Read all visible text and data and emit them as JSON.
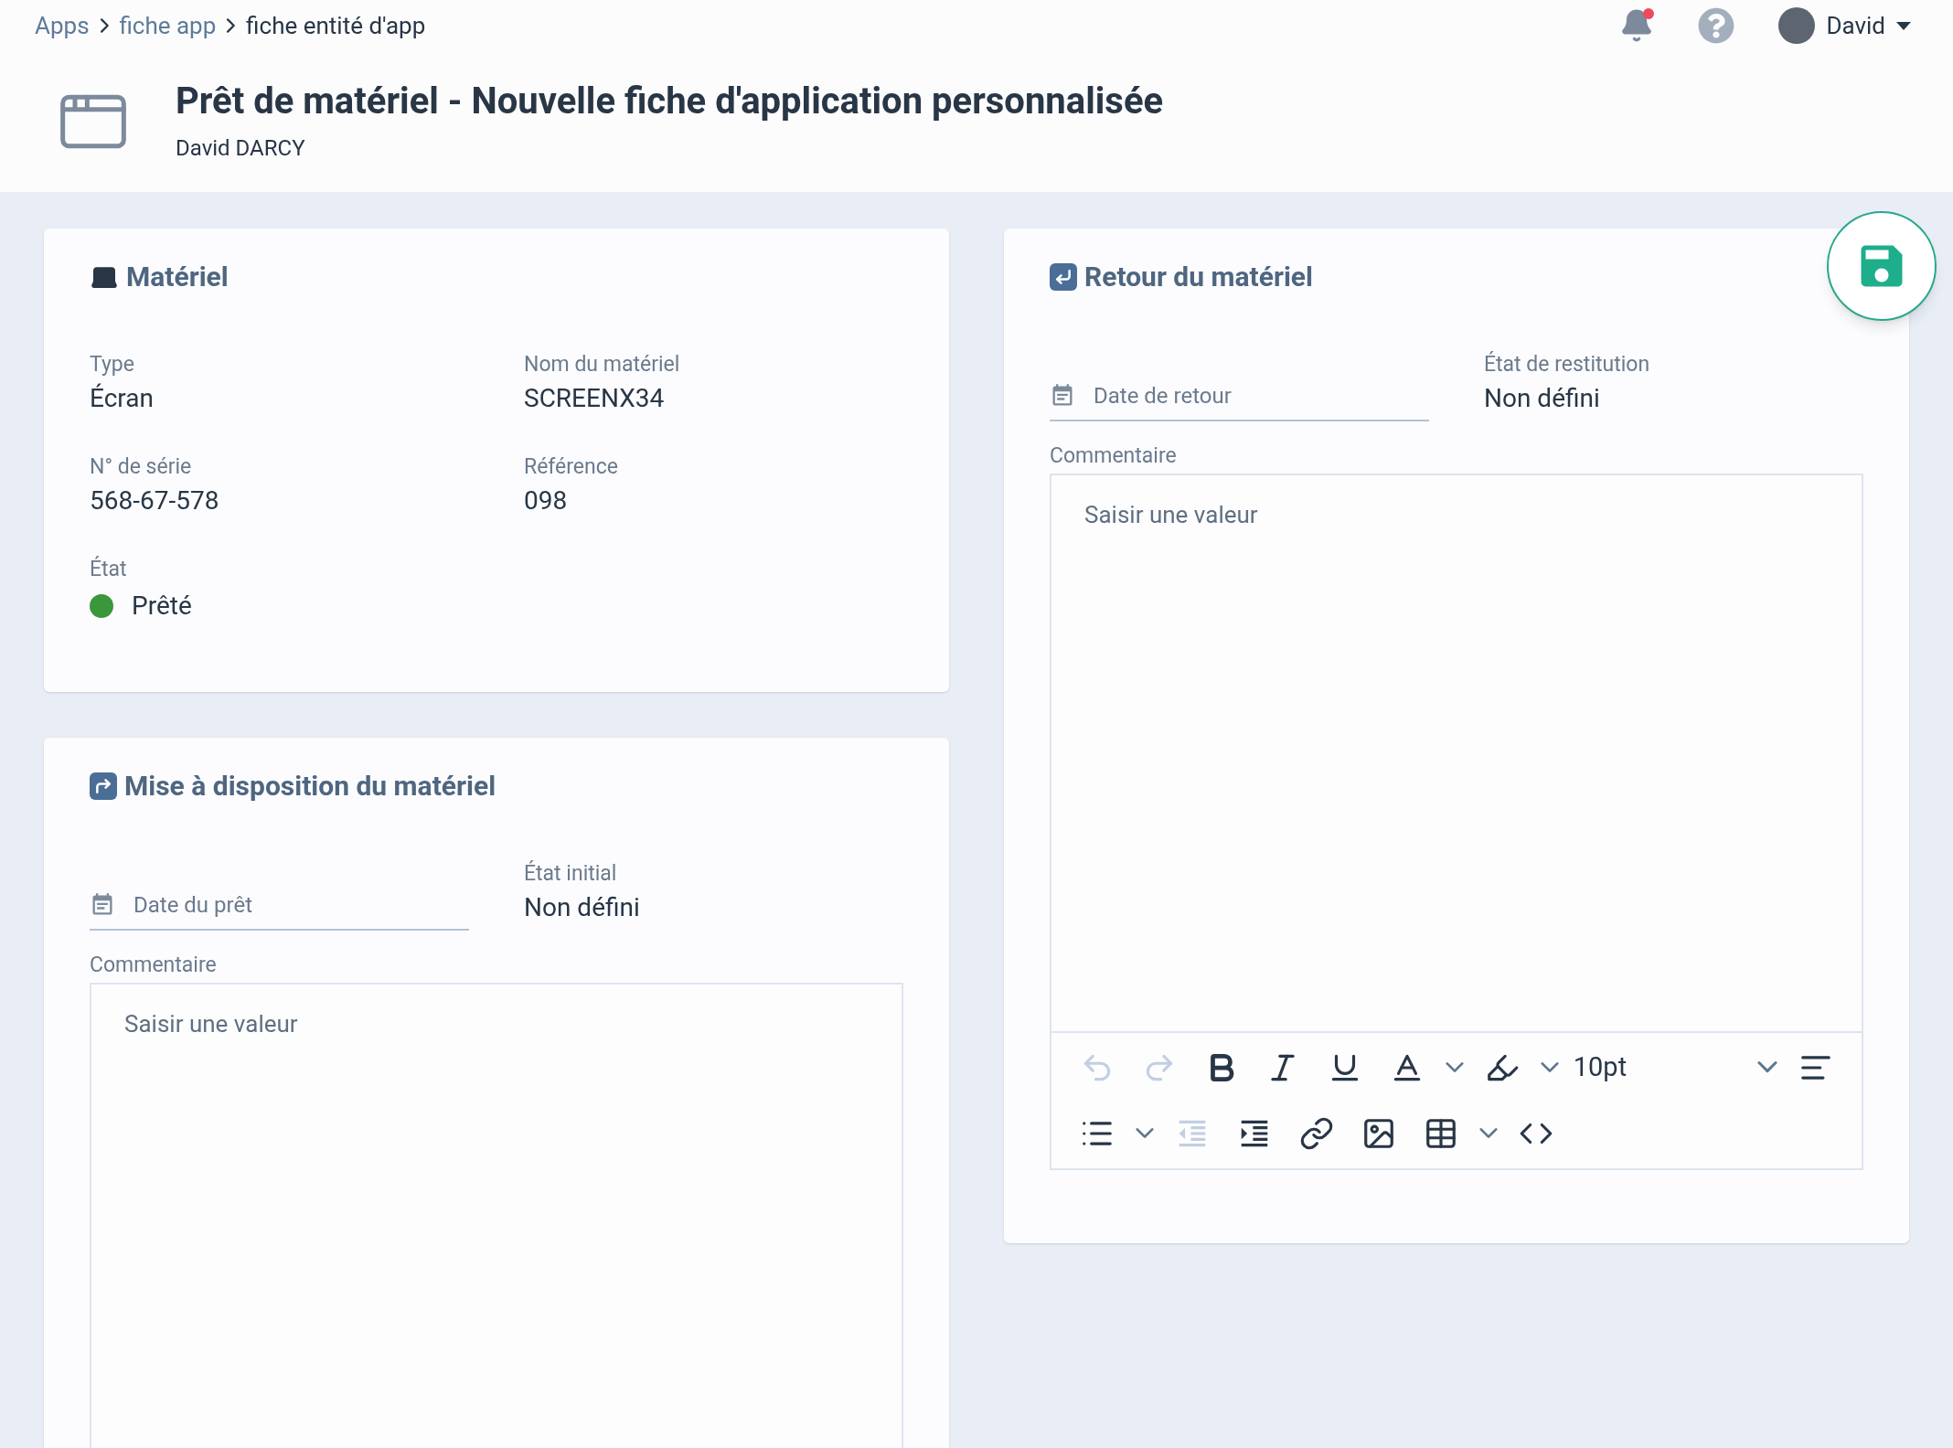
{
  "breadcrumb": [
    {
      "label": "Apps"
    },
    {
      "label": "fiche app"
    },
    {
      "label": "fiche entité d'app"
    }
  ],
  "notifications": {
    "unread": true
  },
  "user": {
    "name": "David"
  },
  "page": {
    "title": "Prêt de matériel - Nouvelle fiche d'application personnalisée",
    "subtitle": "David DARCY"
  },
  "material": {
    "title": "Matériel",
    "fields": [
      {
        "label": "Type",
        "value": "Écran"
      },
      {
        "label": "Nom du matériel",
        "value": "SCREENX34"
      },
      {
        "label": "N° de série",
        "value": "568-67-578"
      },
      {
        "label": "Référence",
        "value": "098"
      }
    ],
    "status": {
      "label": "État",
      "value": "Prêté",
      "color": "#3a973b"
    }
  },
  "loan": {
    "title": "Mise à disposition du matériel",
    "date": {
      "placeholder": "Date du prêt"
    },
    "state": {
      "label": "État initial",
      "value": "Non défini"
    },
    "comment": {
      "label": "Commentaire",
      "placeholder": "Saisir une valeur"
    }
  },
  "return": {
    "title": "Retour du matériel",
    "date": {
      "placeholder": "Date de retour"
    },
    "state": {
      "label": "État de restitution",
      "value": "Non défini"
    },
    "comment": {
      "label": "Commentaire",
      "placeholder": "Saisir une valeur"
    },
    "toolbar": [
      [
        {
          "kind": "undo",
          "disabled": true
        },
        {
          "kind": "redo",
          "disabled": true
        },
        {
          "kind": "bold",
          "disabled": false
        },
        {
          "kind": "italic",
          "disabled": false
        },
        {
          "kind": "underline",
          "disabled": false
        },
        {
          "kind": "textcolor",
          "disabled": false
        },
        {
          "kind": "caret",
          "disabled": false
        },
        {
          "kind": "highlight",
          "disabled": false
        },
        {
          "kind": "caret",
          "disabled": false
        },
        {
          "kind": "fontsize",
          "value": "10pt",
          "disabled": false
        },
        {
          "kind": "align",
          "disabled": false
        }
      ],
      [
        {
          "kind": "bullets",
          "disabled": false
        },
        {
          "kind": "caret",
          "disabled": false
        },
        {
          "kind": "outdent",
          "disabled": true
        },
        {
          "kind": "indent",
          "disabled": false
        },
        {
          "kind": "link",
          "disabled": false
        },
        {
          "kind": "image",
          "disabled": false
        },
        {
          "kind": "table",
          "disabled": false
        },
        {
          "kind": "caret",
          "disabled": false
        },
        {
          "kind": "code",
          "disabled": false
        }
      ]
    ]
  }
}
